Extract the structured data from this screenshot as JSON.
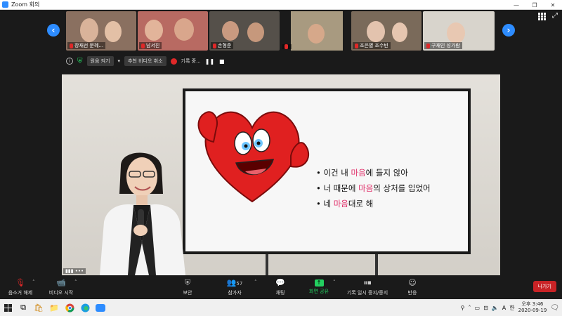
{
  "window": {
    "title": "Zoom 회의",
    "controls": [
      "—",
      "❐",
      "✕"
    ]
  },
  "gallery": {
    "prev_icon": "chevron-left-icon",
    "next_icon": "chevron-right-icon",
    "participants": [
      {
        "name": "장재선 문혜...",
        "muted": true,
        "bg": "#8a7060"
      },
      {
        "name": "남서진",
        "muted": true,
        "bg": "#b86a62"
      },
      {
        "name": "손형준",
        "muted": true,
        "bg": "#55504a"
      },
      {
        "name": "",
        "muted": true,
        "bg": "#a89a80"
      },
      {
        "name": "조은별 조수빈",
        "muted": true,
        "bg": "#7a6a5a"
      },
      {
        "name": "구재인 성가람",
        "muted": true,
        "bg": "#d8d4cc"
      }
    ]
  },
  "recbar": {
    "original_sound": "원음 켜기",
    "unpin_video": "추천 비디오 취소",
    "recording": "기록 중...",
    "pause": "❚❚",
    "stop": "■"
  },
  "slide": {
    "bullets": [
      {
        "pre": "• 이건 내 ",
        "hl": "마음",
        "post": "에 들지 않아"
      },
      {
        "pre": "• 너 때문에 ",
        "hl": "마음",
        "post": "의 상처를 입었어"
      },
      {
        "pre": "• 네 ",
        "hl": "마음",
        "post": "대로 해"
      }
    ]
  },
  "video": {
    "signal": "▮▮▮ •••"
  },
  "controls": {
    "unmute": "음소거 해제",
    "start_video": "비디오 시작",
    "security": "보안",
    "participants": "참가자",
    "participant_count": "57",
    "chat": "채팅",
    "share_screen": "화면 공유",
    "pause_stop_recording": "기록 일시 중지/중지",
    "reactions": "반응",
    "leave": "나가기"
  },
  "taskbar": {
    "ime": "A",
    "ime2": "한",
    "time_period": "오후 3:46",
    "date": "2020-09-19"
  },
  "colors": {
    "accent": "#2d8cff",
    "leave": "#c82326",
    "share": "#23d160",
    "highlight": "#e0336c"
  }
}
